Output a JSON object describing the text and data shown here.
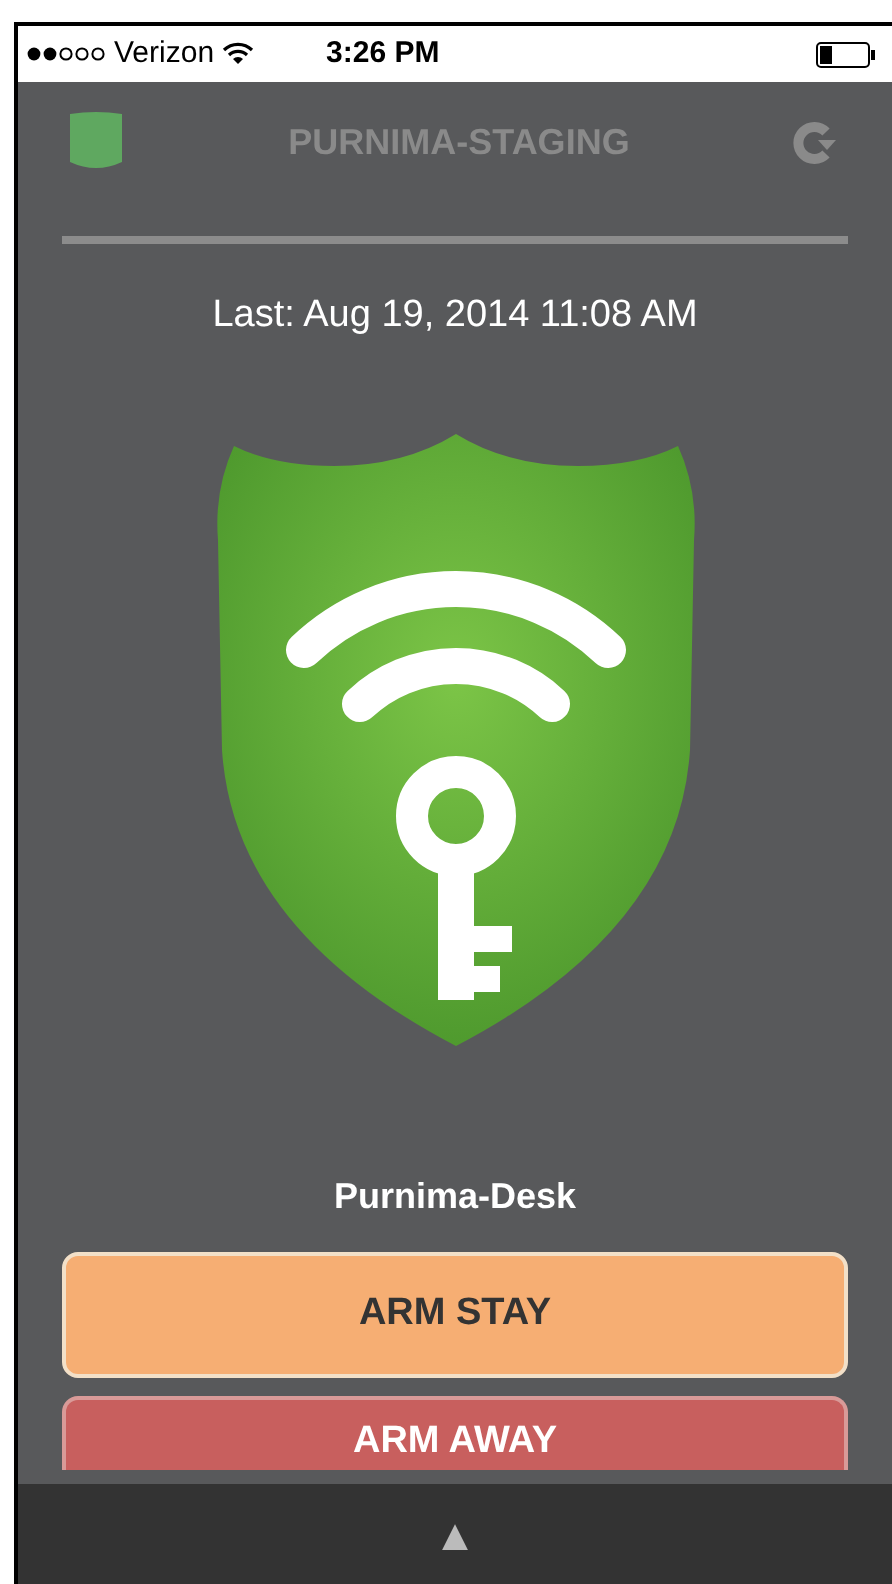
{
  "status_bar": {
    "carrier": "Verizon",
    "time": "3:26 PM"
  },
  "header": {
    "title": "PURNIMA-STAGING"
  },
  "last_update": "Last: Aug 19, 2014 11:08 AM",
  "device": {
    "name": "Purnima-Desk"
  },
  "buttons": [
    {
      "label": "ARM STAY",
      "kind": "stay"
    },
    {
      "label": "ARM AWAY",
      "kind": "away"
    }
  ],
  "bottom_bar": {
    "label": "▲"
  }
}
